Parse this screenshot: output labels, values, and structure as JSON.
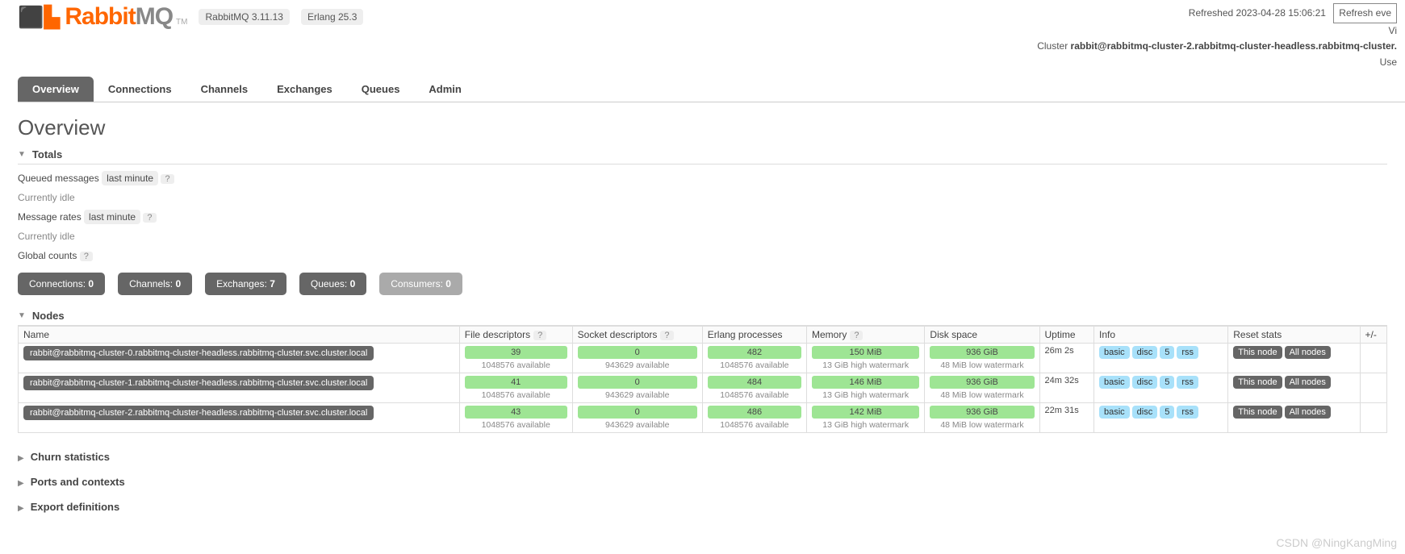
{
  "header": {
    "brand_rabbit": "Rabbit",
    "brand_mq": "MQ",
    "tm": "TM",
    "version": "RabbitMQ 3.11.13",
    "erlang": "Erlang 25.3",
    "refreshed_label": "Refreshed",
    "refreshed_time": "2023-04-28 15:06:21",
    "refresh_btn": "Refresh eve",
    "vi_label": "Vi",
    "cluster_label": "Cluster",
    "cluster_name": "rabbit@rabbitmq-cluster-2.rabbitmq-cluster-headless.rabbitmq-cluster.",
    "user_label": "Use"
  },
  "tabs": [
    "Overview",
    "Connections",
    "Channels",
    "Exchanges",
    "Queues",
    "Admin"
  ],
  "page_title": "Overview",
  "totals": {
    "section_label": "Totals",
    "queued_label": "Queued messages",
    "last_minute": "last minute",
    "idle": "Currently idle",
    "rates_label": "Message rates",
    "global_counts_label": "Global counts",
    "counts": [
      {
        "label": "Connections:",
        "value": "0",
        "disabled": false
      },
      {
        "label": "Channels:",
        "value": "0",
        "disabled": false
      },
      {
        "label": "Exchanges:",
        "value": "7",
        "disabled": false
      },
      {
        "label": "Queues:",
        "value": "0",
        "disabled": false
      },
      {
        "label": "Consumers:",
        "value": "0",
        "disabled": true
      }
    ]
  },
  "nodes_section": {
    "label": "Nodes",
    "headers": {
      "name": "Name",
      "fd": "File descriptors",
      "sd": "Socket descriptors",
      "ep": "Erlang processes",
      "mem": "Memory",
      "disk": "Disk space",
      "uptime": "Uptime",
      "info": "Info",
      "reset": "Reset stats",
      "pm": "+/-"
    },
    "info_tags": [
      "basic",
      "disc",
      "5",
      "rss"
    ],
    "reset_buttons": {
      "this": "This node",
      "all": "All nodes"
    },
    "rows": [
      {
        "name": "rabbit@rabbitmq-cluster-0.rabbitmq-cluster-headless.rabbitmq-cluster.svc.cluster.local",
        "fd_val": "39",
        "fd_sub": "1048576 available",
        "sd_val": "0",
        "sd_sub": "943629 available",
        "ep_val": "482",
        "ep_sub": "1048576 available",
        "mem_val": "150 MiB",
        "mem_sub": "13 GiB high watermark",
        "disk_val": "936 GiB",
        "disk_sub": "48 MiB low watermark",
        "uptime": "26m 2s"
      },
      {
        "name": "rabbit@rabbitmq-cluster-1.rabbitmq-cluster-headless.rabbitmq-cluster.svc.cluster.local",
        "fd_val": "41",
        "fd_sub": "1048576 available",
        "sd_val": "0",
        "sd_sub": "943629 available",
        "ep_val": "484",
        "ep_sub": "1048576 available",
        "mem_val": "146 MiB",
        "mem_sub": "13 GiB high watermark",
        "disk_val": "936 GiB",
        "disk_sub": "48 MiB low watermark",
        "uptime": "24m 32s"
      },
      {
        "name": "rabbit@rabbitmq-cluster-2.rabbitmq-cluster-headless.rabbitmq-cluster.svc.cluster.local",
        "fd_val": "43",
        "fd_sub": "1048576 available",
        "sd_val": "0",
        "sd_sub": "943629 available",
        "ep_val": "486",
        "ep_sub": "1048576 available",
        "mem_val": "142 MiB",
        "mem_sub": "13 GiB high watermark",
        "disk_val": "936 GiB",
        "disk_sub": "48 MiB low watermark",
        "uptime": "22m 31s"
      }
    ]
  },
  "closed_sections": [
    "Churn statistics",
    "Ports and contexts",
    "Export definitions"
  ],
  "watermark": "CSDN @NingKangMing",
  "help_q": "?"
}
